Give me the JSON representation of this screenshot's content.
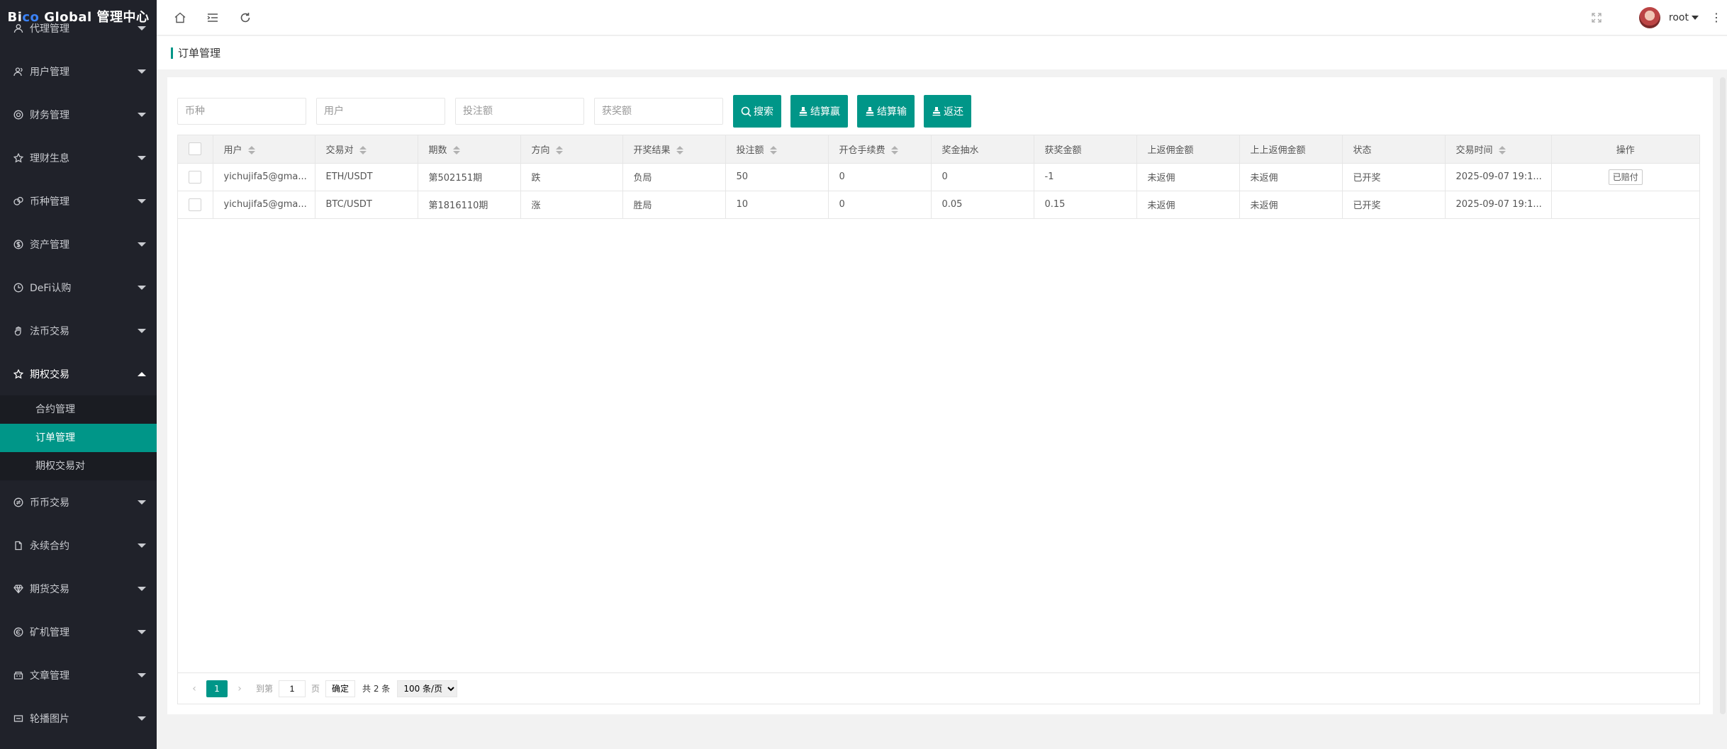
{
  "app": {
    "logo_prefix": "Bi",
    "logo_co": "co",
    "logo_suffix": " Global 管理中心"
  },
  "sidebar": {
    "items": [
      {
        "label": "代理管理",
        "icon": "user-icon"
      },
      {
        "label": "用户管理",
        "icon": "users-icon"
      },
      {
        "label": "财务管理",
        "icon": "finance-icon"
      },
      {
        "label": "理财生息",
        "icon": "star-icon"
      },
      {
        "label": "币种管理",
        "icon": "coin-icon"
      },
      {
        "label": "资产管理",
        "icon": "dollar-icon"
      },
      {
        "label": "DeFi认购",
        "icon": "clock-icon"
      },
      {
        "label": "法币交易",
        "icon": "hand-icon"
      },
      {
        "label": "期权交易",
        "icon": "star-icon"
      },
      {
        "label": "币币交易",
        "icon": "exchange-icon"
      },
      {
        "label": "永续合约",
        "icon": "document-icon"
      },
      {
        "label": "期货交易",
        "icon": "diamond-icon"
      },
      {
        "label": "矿机管理",
        "icon": "mining-icon"
      },
      {
        "label": "文章管理",
        "icon": "article-icon"
      },
      {
        "label": "轮播图片",
        "icon": "image-icon"
      }
    ],
    "submenu": [
      {
        "label": "合约管理"
      },
      {
        "label": "订单管理"
      },
      {
        "label": "期权交易对"
      }
    ]
  },
  "header": {
    "username": "root"
  },
  "breadcrumb": {
    "title": "订单管理"
  },
  "filters": {
    "currency_placeholder": "币种",
    "user_placeholder": "用户",
    "bet_placeholder": "投注额",
    "win_placeholder": "获奖额",
    "search_label": "搜索",
    "settle_win_label": "结算赢",
    "settle_lose_label": "结算输",
    "return_label": "返还"
  },
  "table": {
    "headers": [
      "用户",
      "交易对",
      "期数",
      "方向",
      "开奖结果",
      "投注额",
      "开仓手续费",
      "奖金抽水",
      "获奖金额",
      "上返佣金额",
      "上上返佣金额",
      "状态",
      "交易时间",
      "操作"
    ],
    "rows": [
      {
        "user": "yichujifa5@gma...",
        "pair": "ETH/USDT",
        "period": "第502151期",
        "direction": "跌",
        "result": "负局",
        "bet": "50",
        "fee": "0",
        "commission": "0",
        "win": "-1",
        "rebate1": "未返佣",
        "rebate2": "未返佣",
        "status": "已开奖",
        "time": "2025-09-07 19:1...",
        "op": "已赔付"
      },
      {
        "user": "yichujifa5@gma...",
        "pair": "BTC/USDT",
        "period": "第1816110期",
        "direction": "涨",
        "result": "胜局",
        "bet": "10",
        "fee": "0",
        "commission": "0.05",
        "win": "0.15",
        "rebate1": "未返佣",
        "rebate2": "未返佣",
        "status": "已开奖",
        "time": "2025-09-07 19:1...",
        "op": ""
      }
    ]
  },
  "pager": {
    "current": "1",
    "goto_label": "到第",
    "goto_value": "1",
    "page_label": "页",
    "ok_label": "确定",
    "total": "共 2 条",
    "per_page": "100 条/页"
  }
}
